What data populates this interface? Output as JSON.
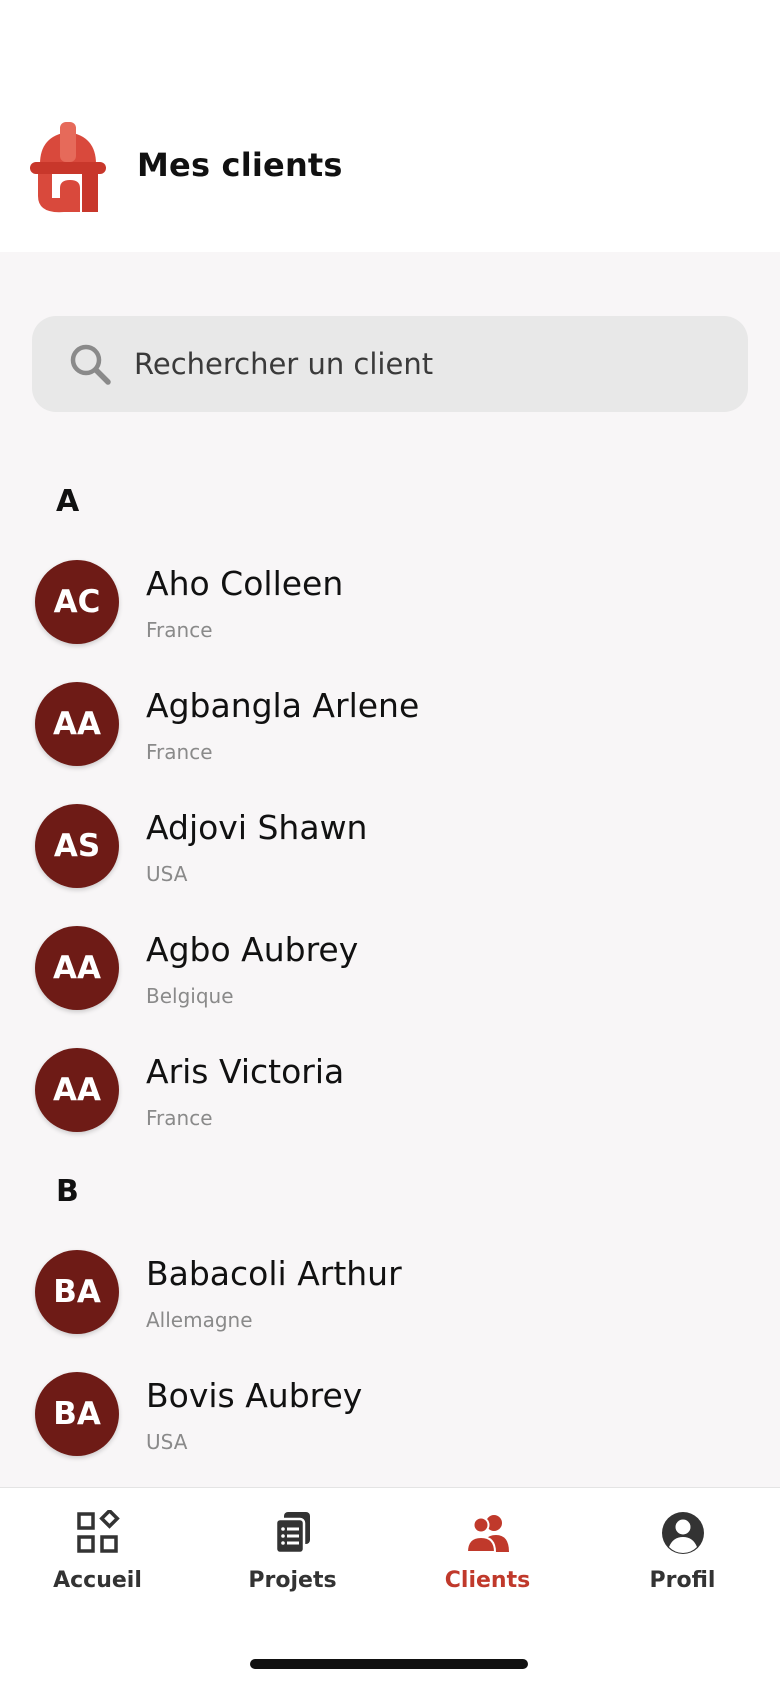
{
  "header": {
    "title": "Mes clients",
    "logo": "helmet-logo"
  },
  "search": {
    "placeholder": "Rechercher un client",
    "value": "",
    "icon": "search-icon"
  },
  "sections": [
    {
      "letter": "A",
      "clients": [
        {
          "initials": "AC",
          "name": "Aho Colleen",
          "country": "France"
        },
        {
          "initials": "AA",
          "name": "Agbangla Arlene",
          "country": "France"
        },
        {
          "initials": "AS",
          "name": "Adjovi Shawn",
          "country": "USA"
        },
        {
          "initials": "AA",
          "name": "Agbo Aubrey",
          "country": "Belgique"
        },
        {
          "initials": "AA",
          "name": "Aris Victoria",
          "country": "France"
        }
      ]
    },
    {
      "letter": "B",
      "clients": [
        {
          "initials": "BA",
          "name": "Babacoli Arthur",
          "country": "Allemagne"
        },
        {
          "initials": "BA",
          "name": "Bovis Aubrey",
          "country": "USA"
        }
      ]
    }
  ],
  "tabs": [
    {
      "label": "Accueil",
      "icon": "dashboard-icon",
      "active": false
    },
    {
      "label": "Projets",
      "icon": "documents-icon",
      "active": false
    },
    {
      "label": "Clients",
      "icon": "users-icon",
      "active": true
    },
    {
      "label": "Profil",
      "icon": "profile-icon",
      "active": false
    }
  ],
  "colors": {
    "accent": "#c0392b",
    "avatar": "#6e1b16",
    "search_bg": "#e8e8e8",
    "background": "#f8f6f7"
  }
}
